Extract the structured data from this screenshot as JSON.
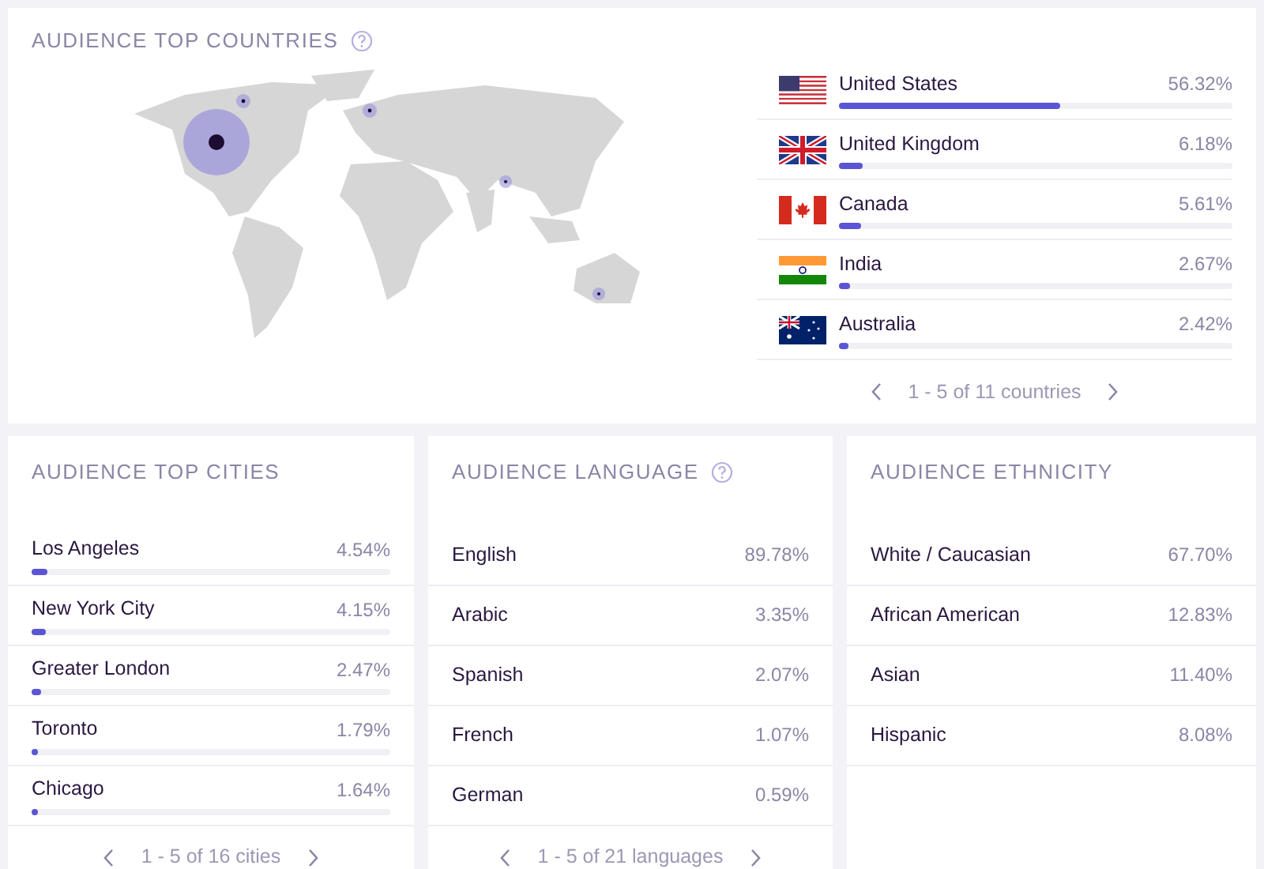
{
  "countries": {
    "title": "AUDIENCE TOP COUNTRIES",
    "help": true,
    "items": [
      {
        "kind": "us",
        "name": "United States",
        "value": "56.32%",
        "level": 0.5632
      },
      {
        "kind": "gb",
        "name": "United Kingdom",
        "value": "6.18%",
        "level": 0.0618
      },
      {
        "kind": "ca",
        "name": "Canada",
        "value": "5.61%",
        "level": 0.0561
      },
      {
        "kind": "in",
        "name": "India",
        "value": "2.67%",
        "level": 0.0267
      },
      {
        "kind": "au",
        "name": "Australia",
        "value": "2.42%",
        "level": 0.0242
      }
    ],
    "pager": "1 - 5 of 11 countries"
  },
  "cities": {
    "title": "AUDIENCE TOP CITIES",
    "help": false,
    "items": [
      {
        "name": "Los Angeles",
        "value": "4.54%",
        "level": 0.0454
      },
      {
        "name": "New York City",
        "value": "4.15%",
        "level": 0.0415
      },
      {
        "name": "Greater London",
        "value": "2.47%",
        "level": 0.0247
      },
      {
        "name": "Toronto",
        "value": "1.79%",
        "level": 0.0179
      },
      {
        "name": "Chicago",
        "value": "1.64%",
        "level": 0.0164
      }
    ],
    "pager": "1 - 5 of 16 cities"
  },
  "language": {
    "title": "AUDIENCE LANGUAGE",
    "help": true,
    "items": [
      {
        "name": "English",
        "value": "89.78%"
      },
      {
        "name": "Arabic",
        "value": "3.35%"
      },
      {
        "name": "Spanish",
        "value": "2.07%"
      },
      {
        "name": "French",
        "value": "1.07%"
      },
      {
        "name": "German",
        "value": "0.59%"
      }
    ],
    "pager": "1 - 5 of 21 languages"
  },
  "ethnicity": {
    "title": "AUDIENCE ETHNICITY",
    "help": false,
    "items": [
      {
        "name": "White / Caucasian",
        "value": "67.70%"
      },
      {
        "name": "African American",
        "value": "12.83%"
      },
      {
        "name": "Asian",
        "value": "11.40%"
      },
      {
        "name": "Hispanic",
        "value": "8.08%"
      }
    ]
  }
}
